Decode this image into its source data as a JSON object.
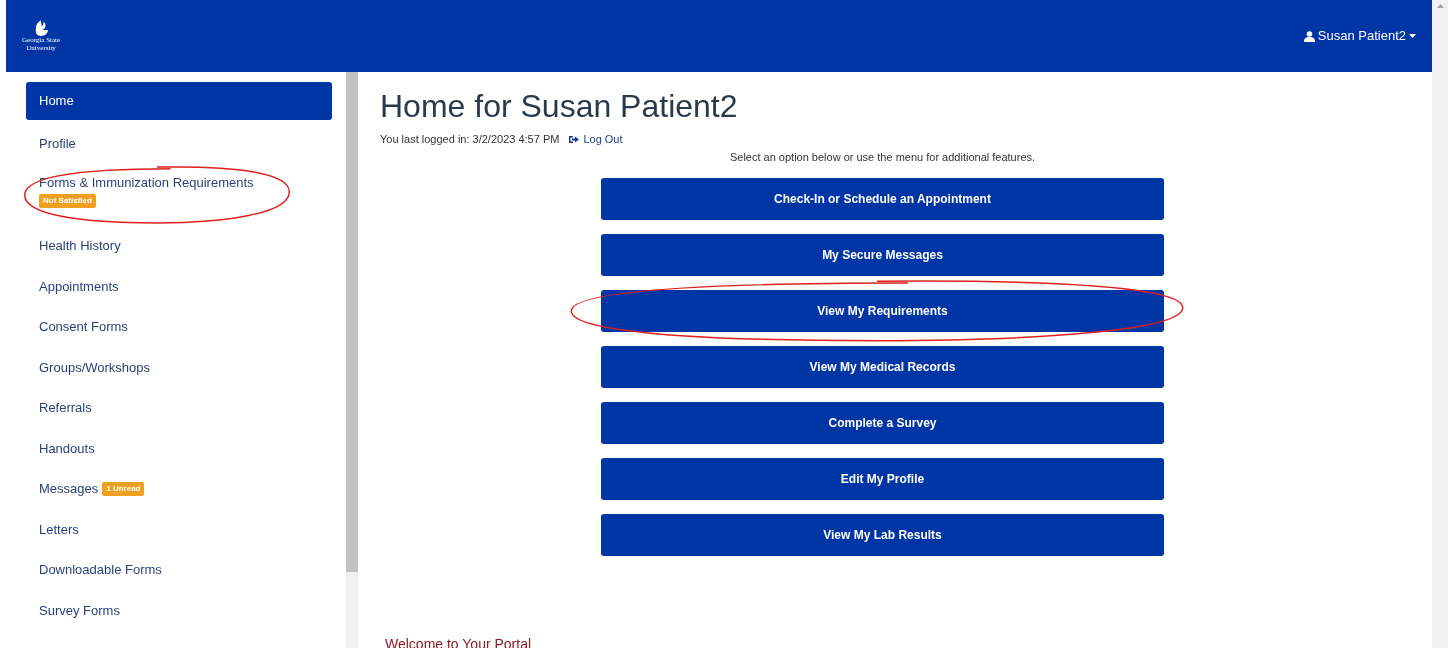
{
  "header": {
    "logo_text": [
      "Georgia State",
      "University"
    ],
    "user_menu": "Susan Patient2"
  },
  "sidebar": {
    "items": [
      {
        "label": "Home",
        "selected": true,
        "circled": false
      },
      {
        "label": "Profile",
        "selected": false,
        "circled": false
      },
      {
        "label": "Forms & Immunization Requirements",
        "selected": false,
        "circled": true,
        "badge": "Not Satisfied",
        "badge_below": true
      },
      {
        "label": "Health History",
        "selected": false,
        "circled": false
      },
      {
        "label": "Appointments",
        "selected": false,
        "circled": false
      },
      {
        "label": "Consent Forms",
        "selected": false,
        "circled": false
      },
      {
        "label": "Groups/Workshops",
        "selected": false,
        "circled": false
      },
      {
        "label": "Referrals",
        "selected": false,
        "circled": false
      },
      {
        "label": "Handouts",
        "selected": false,
        "circled": false
      },
      {
        "label": "Messages",
        "selected": false,
        "circled": false,
        "badge": "1 Unread",
        "badge_below": false
      },
      {
        "label": "Letters",
        "selected": false,
        "circled": false
      },
      {
        "label": "Downloadable Forms",
        "selected": false,
        "circled": false
      },
      {
        "label": "Survey Forms",
        "selected": false,
        "circled": false
      }
    ]
  },
  "main": {
    "title": "Home for Susan Patient2",
    "last_login": "You last logged in: 3/2/2023 4:57 PM",
    "logout": "Log Out",
    "instructions": "Select an option below or use the menu for additional features.",
    "buttons": [
      {
        "label": "Check-In or Schedule an Appointment",
        "circled": false
      },
      {
        "label": "My Secure Messages",
        "circled": false
      },
      {
        "label": "View My Requirements",
        "circled": true
      },
      {
        "label": "View My Medical Records",
        "circled": false
      },
      {
        "label": "Complete a Survey",
        "circled": false
      },
      {
        "label": "Edit My Profile",
        "circled": false
      },
      {
        "label": "View My Lab Results",
        "circled": false
      }
    ],
    "welcome": "Welcome to Your Portal"
  }
}
